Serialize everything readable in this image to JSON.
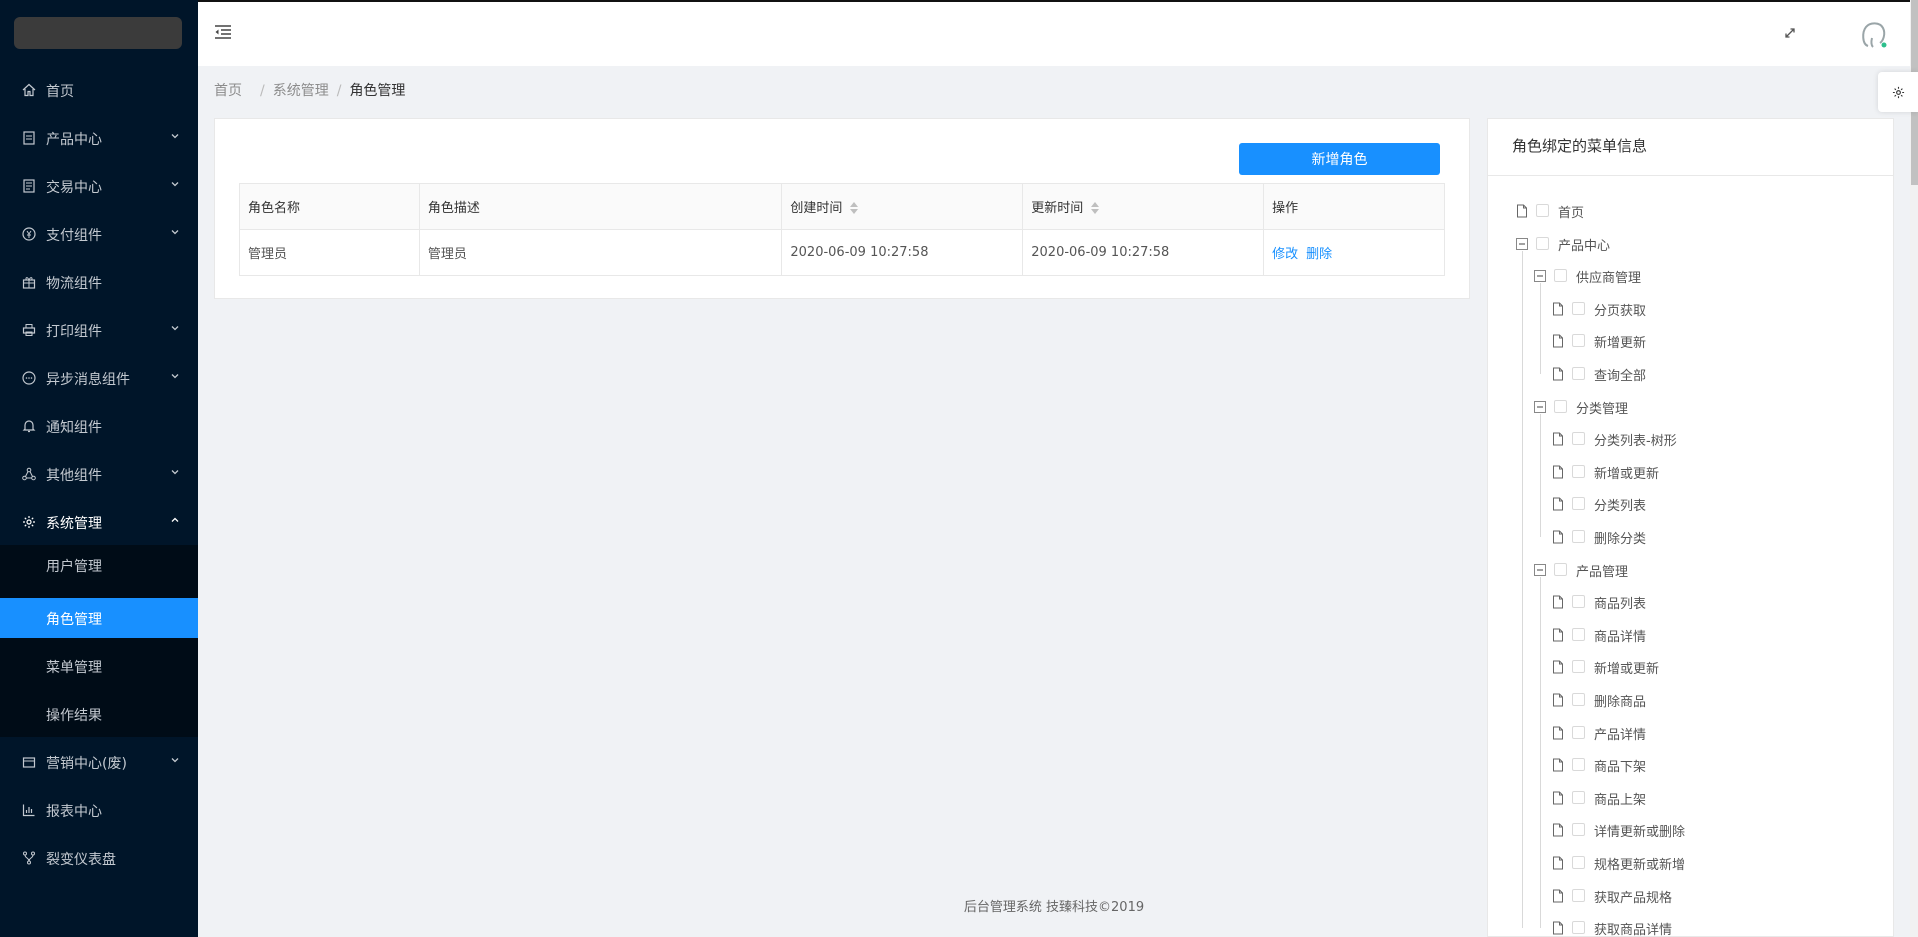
{
  "sidebar": {
    "items": [
      {
        "label": "首页",
        "icon": "home-icon",
        "has_children": false
      },
      {
        "label": "产品中心",
        "icon": "product-icon",
        "has_children": true
      },
      {
        "label": "交易中心",
        "icon": "trade-icon",
        "has_children": true
      },
      {
        "label": "支付组件",
        "icon": "payment-icon",
        "has_children": true
      },
      {
        "label": "物流组件",
        "icon": "gift-icon",
        "has_children": false
      },
      {
        "label": "打印组件",
        "icon": "printer-icon",
        "has_children": true
      },
      {
        "label": "异步消息组件",
        "icon": "message-icon",
        "has_children": true
      },
      {
        "label": "通知组件",
        "icon": "bell-icon",
        "has_children": false
      },
      {
        "label": "其他组件",
        "icon": "cluster-icon",
        "has_children": true
      },
      {
        "label": "系统管理",
        "icon": "gear-icon",
        "has_children": true,
        "expanded": true
      },
      {
        "label": "营销中心(废)",
        "icon": "wallet-icon",
        "has_children": true
      },
      {
        "label": "报表中心",
        "icon": "bar-chart-icon",
        "has_children": false
      },
      {
        "label": "裂变仪表盘",
        "icon": "fork-icon",
        "has_children": false
      }
    ],
    "submenu": [
      {
        "label": "用户管理",
        "active": false
      },
      {
        "label": "角色管理",
        "active": true
      },
      {
        "label": "菜单管理",
        "active": false
      },
      {
        "label": "操作结果",
        "active": false
      }
    ]
  },
  "breadcrumb": [
    "首页",
    "系统管理",
    "角色管理"
  ],
  "toolbar": {
    "add_label": "新增角色"
  },
  "table": {
    "columns": [
      "角色名称",
      "角色描述",
      "创建时间",
      "更新时间",
      "操作"
    ],
    "rows": [
      {
        "name": "管理员",
        "desc": "管理员",
        "created": "2020-06-09 10:27:58",
        "updated": "2020-06-09 10:27:58"
      }
    ],
    "actions": {
      "edit": "修改",
      "delete": "删除"
    }
  },
  "panel": {
    "title": "角色绑定的菜单信息",
    "tree": [
      {
        "label": "首页",
        "level": 0,
        "leaf": true
      },
      {
        "label": "产品中心",
        "level": 0,
        "leaf": false
      },
      {
        "label": "供应商管理",
        "level": 1,
        "leaf": false
      },
      {
        "label": "分页获取",
        "level": 2,
        "leaf": true
      },
      {
        "label": "新增更新",
        "level": 2,
        "leaf": true
      },
      {
        "label": "查询全部",
        "level": 2,
        "leaf": true
      },
      {
        "label": "分类管理",
        "level": 1,
        "leaf": false
      },
      {
        "label": "分类列表-树形",
        "level": 2,
        "leaf": true
      },
      {
        "label": "新增或更新",
        "level": 2,
        "leaf": true
      },
      {
        "label": "分类列表",
        "level": 2,
        "leaf": true
      },
      {
        "label": "删除分类",
        "level": 2,
        "leaf": true
      },
      {
        "label": "产品管理",
        "level": 1,
        "leaf": false
      },
      {
        "label": "商品列表",
        "level": 2,
        "leaf": true
      },
      {
        "label": "商品详情",
        "level": 2,
        "leaf": true
      },
      {
        "label": "新增或更新",
        "level": 2,
        "leaf": true
      },
      {
        "label": "删除商品",
        "level": 2,
        "leaf": true
      },
      {
        "label": "产品详情",
        "level": 2,
        "leaf": true
      },
      {
        "label": "商品下架",
        "level": 2,
        "leaf": true
      },
      {
        "label": "商品上架",
        "level": 2,
        "leaf": true
      },
      {
        "label": "详情更新或删除",
        "level": 2,
        "leaf": true
      },
      {
        "label": "规格更新或新增",
        "level": 2,
        "leaf": true
      },
      {
        "label": "获取产品规格",
        "level": 2,
        "leaf": true
      },
      {
        "label": "获取商品详情",
        "level": 2,
        "leaf": true
      }
    ]
  },
  "footer": {
    "text": "后台管理系统 技臻科技©2019"
  },
  "colors": {
    "sidebar_bg": "#001529",
    "submenu_bg": "#000c17",
    "accent": "#1890ff"
  }
}
